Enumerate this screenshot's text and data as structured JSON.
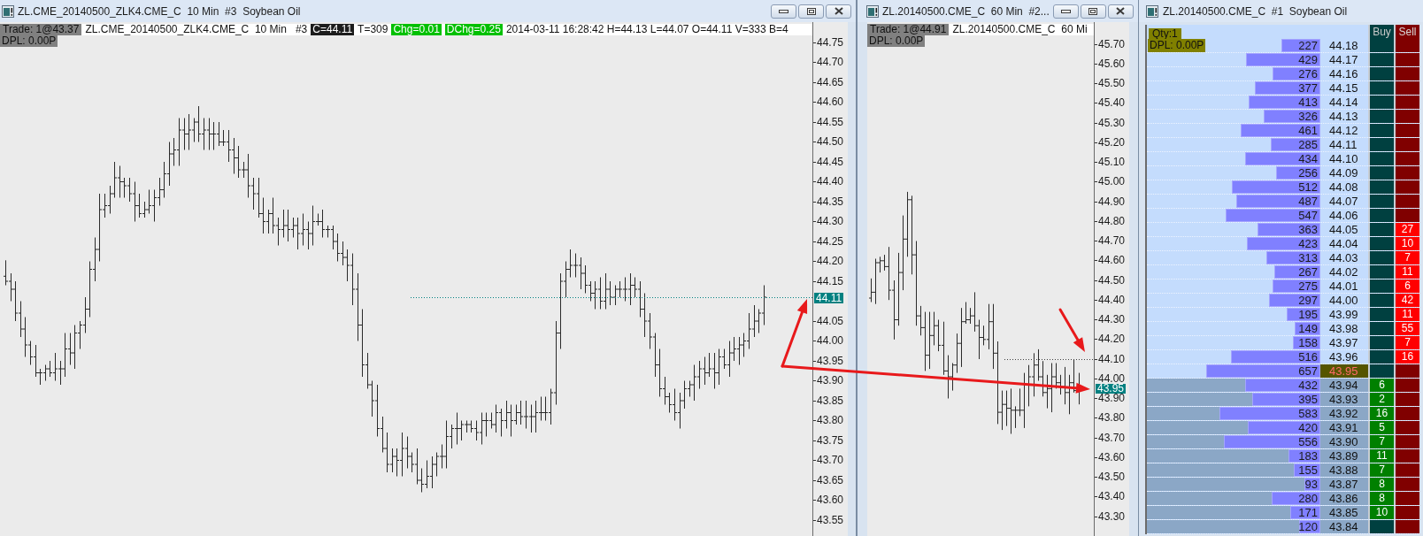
{
  "chart_windows": [
    {
      "title": "ZL.CME_20140500_ZLK4.CME_C  10 Min  #3  Soybean Oil",
      "header": [
        {
          "text": "Trade: 1@43.37",
          "kind": "trade"
        },
        {
          "text": "ZL.CME_20140500_ZLK4.CME_C  10 Min   #3",
          "kind": "plain"
        },
        {
          "text": "C=44.11",
          "kind": "close"
        },
        {
          "text": "T=309",
          "kind": "plain"
        },
        {
          "text": "Chg=0.01",
          "kind": "change"
        },
        {
          "text": "DChg=0.25",
          "kind": "change"
        },
        {
          "text": "2014-03-11 16:28:42 H=44.13 L=44.07 O=44.11 V=333 B=4",
          "kind": "plain"
        }
      ],
      "dpl": "DPL: 0.00P",
      "axis": [
        {
          "label": "44.75",
          "kind": "tick"
        },
        {
          "label": "44.70",
          "kind": "tick"
        },
        {
          "label": "44.65",
          "kind": "tick"
        },
        {
          "label": "44.60",
          "kind": "tick"
        },
        {
          "label": "44.55",
          "kind": "tick"
        },
        {
          "label": "44.50",
          "kind": "tick"
        },
        {
          "label": "44.45",
          "kind": "tick"
        },
        {
          "label": "44.40",
          "kind": "tick"
        },
        {
          "label": "44.35",
          "kind": "tick"
        },
        {
          "label": "44.30",
          "kind": "tick"
        },
        {
          "label": "44.25",
          "kind": "tick"
        },
        {
          "label": "44.20",
          "kind": "tick"
        },
        {
          "label": "44.15",
          "kind": "tick"
        },
        {
          "label": "44.11",
          "kind": "tag_on_tick"
        },
        {
          "label": "44.05",
          "kind": "tick"
        },
        {
          "label": "44.00",
          "kind": "tick"
        },
        {
          "label": "43.95",
          "kind": "tick"
        },
        {
          "label": "43.90",
          "kind": "tick"
        },
        {
          "label": "43.85",
          "kind": "tick"
        },
        {
          "label": "43.80",
          "kind": "tick"
        },
        {
          "label": "43.75",
          "kind": "tick"
        },
        {
          "label": "43.70",
          "kind": "tick"
        },
        {
          "label": "43.65",
          "kind": "tick"
        },
        {
          "label": "43.60",
          "kind": "tick"
        },
        {
          "label": "43.55",
          "kind": "tick"
        }
      ]
    },
    {
      "title": "ZL.20140500.CME_C  60 Min  #2...",
      "header": [
        {
          "text": "Trade: 1@44.91",
          "kind": "trade"
        },
        {
          "text": "ZL.20140500.CME_C  60 Mi",
          "kind": "plain"
        }
      ],
      "dpl": "DPL: 0.00P",
      "axis": [
        {
          "label": "45.70",
          "kind": "tick"
        },
        {
          "label": "45.60",
          "kind": "tick"
        },
        {
          "label": "45.50",
          "kind": "tick"
        },
        {
          "label": "45.40",
          "kind": "tick"
        },
        {
          "label": "45.30",
          "kind": "tick"
        },
        {
          "label": "45.20",
          "kind": "tick"
        },
        {
          "label": "45.10",
          "kind": "tick"
        },
        {
          "label": "45.00",
          "kind": "tick"
        },
        {
          "label": "44.90",
          "kind": "tick"
        },
        {
          "label": "44.80",
          "kind": "tick"
        },
        {
          "label": "44.70",
          "kind": "tick"
        },
        {
          "label": "44.60",
          "kind": "tick"
        },
        {
          "label": "44.50",
          "kind": "tick"
        },
        {
          "label": "44.40",
          "kind": "tick"
        },
        {
          "label": "44.30",
          "kind": "tick"
        },
        {
          "label": "44.20",
          "kind": "tick"
        },
        {
          "label": "44.10",
          "kind": "tick"
        },
        {
          "label": "44.00",
          "kind": "tick"
        },
        {
          "label": "43.95",
          "kind": "tag_between"
        },
        {
          "label": "43.90",
          "kind": "tick"
        },
        {
          "label": "43.80",
          "kind": "tick"
        },
        {
          "label": "43.70",
          "kind": "tick"
        },
        {
          "label": "43.60",
          "kind": "tick"
        },
        {
          "label": "43.50",
          "kind": "tick"
        },
        {
          "label": "43.40",
          "kind": "tick"
        },
        {
          "label": "43.30",
          "kind": "tick"
        }
      ]
    }
  ],
  "dom_window": {
    "title": "ZL.20140500.CME_C  #1  Soybean Oil",
    "qty": "Qty:1",
    "dpl": "DPL: 0.00P",
    "columns": [
      "Buy",
      "Sell"
    ],
    "rows": [
      {
        "volume": "227",
        "level": 0.227,
        "price": "44.18",
        "kind": "ask",
        "last": false
      },
      {
        "volume": "429",
        "level": 0.429,
        "price": "44.17",
        "kind": "ask",
        "last": false
      },
      {
        "volume": "276",
        "level": 0.276,
        "price": "44.16",
        "kind": "ask",
        "last": false
      },
      {
        "volume": "377",
        "level": 0.377,
        "price": "44.15",
        "kind": "ask",
        "last": false
      },
      {
        "volume": "413",
        "level": 0.413,
        "price": "44.14",
        "kind": "ask",
        "last": false
      },
      {
        "volume": "326",
        "level": 0.326,
        "price": "44.13",
        "kind": "ask",
        "last": false
      },
      {
        "volume": "461",
        "level": 0.461,
        "price": "44.12",
        "kind": "ask",
        "last": false
      },
      {
        "volume": "285",
        "level": 0.285,
        "price": "44.11",
        "kind": "ask",
        "last": false
      },
      {
        "volume": "434",
        "level": 0.434,
        "price": "44.10",
        "kind": "ask",
        "last": false
      },
      {
        "volume": "256",
        "level": 0.256,
        "price": "44.09",
        "kind": "ask",
        "last": false
      },
      {
        "volume": "512",
        "level": 0.512,
        "price": "44.08",
        "kind": "ask",
        "last": false
      },
      {
        "volume": "487",
        "level": 0.487,
        "price": "44.07",
        "kind": "ask",
        "last": false
      },
      {
        "volume": "547",
        "level": 0.547,
        "price": "44.06",
        "kind": "ask",
        "last": false
      },
      {
        "volume": "363",
        "level": 0.363,
        "price": "44.05",
        "kind": "ask",
        "sell": "27",
        "last": false
      },
      {
        "volume": "423",
        "level": 0.423,
        "price": "44.04",
        "kind": "ask",
        "sell": "10",
        "last": false
      },
      {
        "volume": "313",
        "level": 0.313,
        "price": "44.03",
        "kind": "ask",
        "sell": "7",
        "last": false
      },
      {
        "volume": "267",
        "level": 0.267,
        "price": "44.02",
        "kind": "ask",
        "sell": "11",
        "last": false
      },
      {
        "volume": "275",
        "level": 0.275,
        "price": "44.01",
        "kind": "ask",
        "sell": "6",
        "last": false
      },
      {
        "volume": "297",
        "level": 0.297,
        "price": "44.00",
        "kind": "ask",
        "sell": "42",
        "last": false
      },
      {
        "volume": "195",
        "level": 0.195,
        "price": "43.99",
        "kind": "ask",
        "sell": "11",
        "last": false
      },
      {
        "volume": "149",
        "level": 0.149,
        "price": "43.98",
        "kind": "ask",
        "sell": "55",
        "last": false
      },
      {
        "volume": "158",
        "level": 0.158,
        "price": "43.97",
        "kind": "ask",
        "sell": "7",
        "last": false
      },
      {
        "volume": "516",
        "level": 0.516,
        "price": "43.96",
        "kind": "ask",
        "sell": "16",
        "last": false
      },
      {
        "volume": "657",
        "level": 0.657,
        "price": "43.95",
        "kind": "ask",
        "last": true
      },
      {
        "volume": "432",
        "level": 0.432,
        "price": "43.94",
        "kind": "bid",
        "buy": "6",
        "last": false
      },
      {
        "volume": "395",
        "level": 0.395,
        "price": "43.93",
        "kind": "bid",
        "buy": "2",
        "last": false
      },
      {
        "volume": "583",
        "level": 0.583,
        "price": "43.92",
        "kind": "bid",
        "buy": "16",
        "last": false
      },
      {
        "volume": "420",
        "level": 0.42,
        "price": "43.91",
        "kind": "bid",
        "buy": "5",
        "last": false
      },
      {
        "volume": "556",
        "level": 0.556,
        "price": "43.90",
        "kind": "bid",
        "buy": "7",
        "last": false
      },
      {
        "volume": "183",
        "level": 0.183,
        "price": "43.89",
        "kind": "bid",
        "buy": "11",
        "last": false
      },
      {
        "volume": "155",
        "level": 0.155,
        "price": "43.88",
        "kind": "bid",
        "buy": "7",
        "last": false
      },
      {
        "volume": "93",
        "level": 0.093,
        "price": "43.87",
        "kind": "bid",
        "buy": "8",
        "last": false
      },
      {
        "volume": "280",
        "level": 0.28,
        "price": "43.86",
        "kind": "bid",
        "buy": "8",
        "last": false
      },
      {
        "volume": "171",
        "level": 0.171,
        "price": "43.85",
        "kind": "bid",
        "buy": "10",
        "last": false
      },
      {
        "volume": "120",
        "level": 0.12,
        "price": "43.84",
        "kind": "bid",
        "last": false
      }
    ]
  }
}
